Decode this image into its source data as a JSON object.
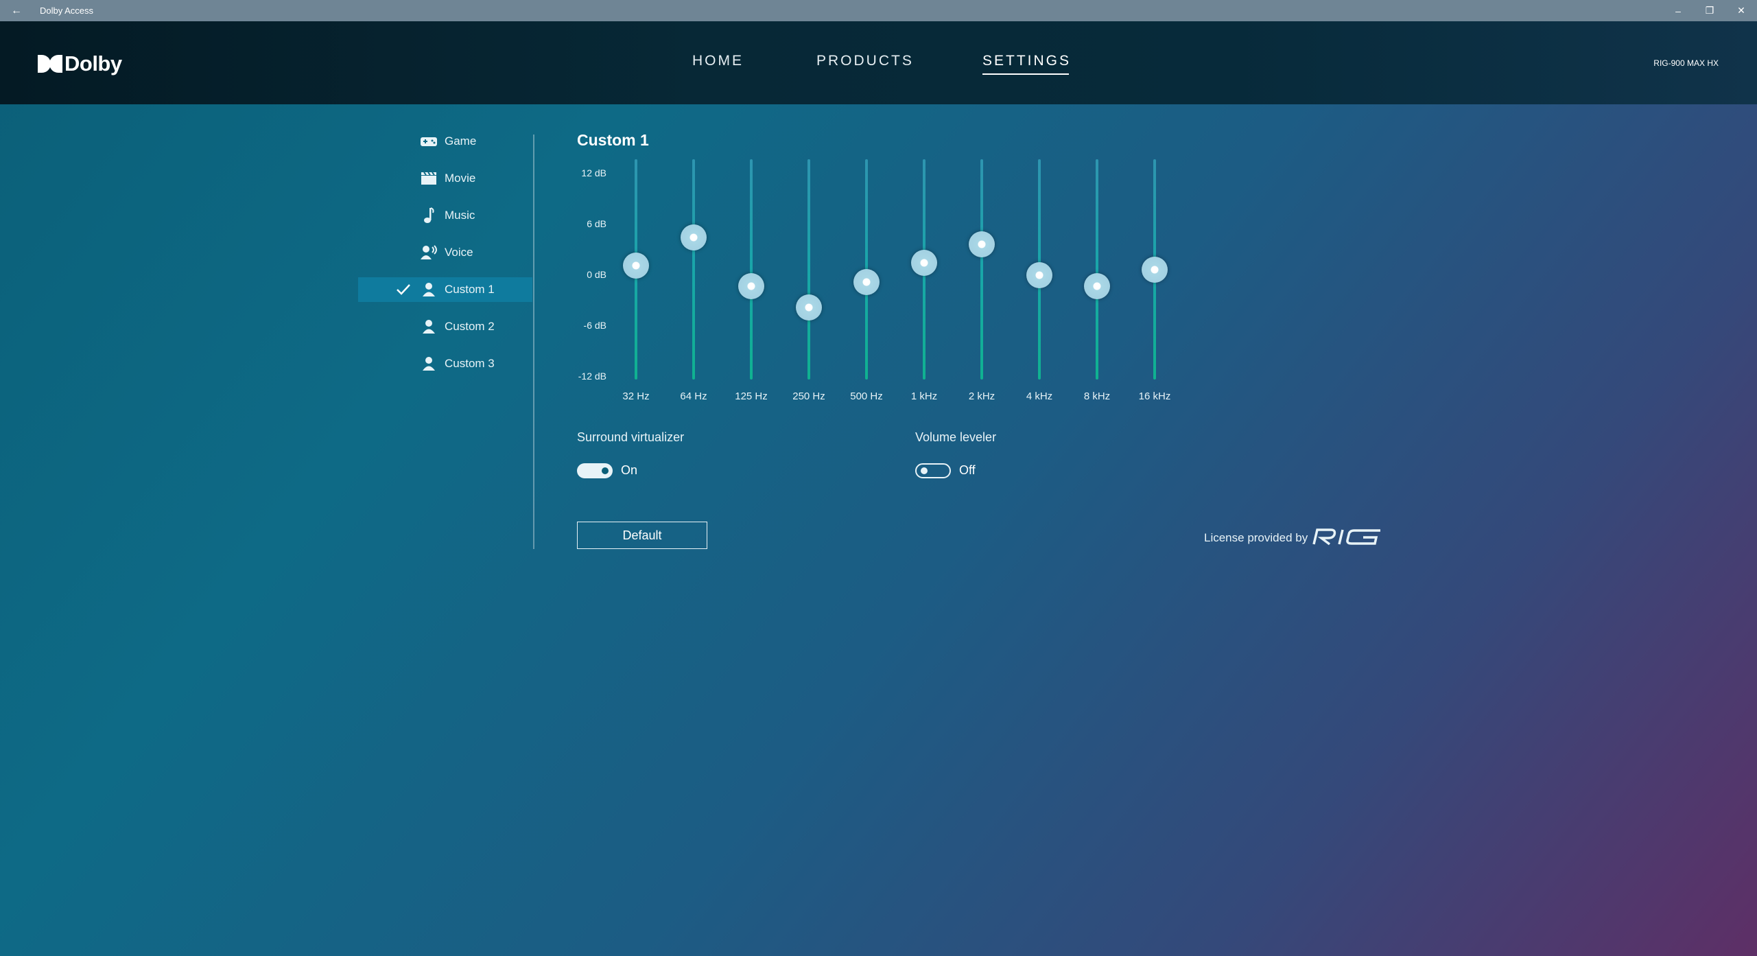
{
  "window": {
    "title": "Dolby Access"
  },
  "brand": {
    "name": "Dolby"
  },
  "nav": [
    {
      "label": "HOME",
      "active": false
    },
    {
      "label": "PRODUCTS",
      "active": false
    },
    {
      "label": "SETTINGS",
      "active": true
    }
  ],
  "device": "RIG-900 MAX HX",
  "sidebar": {
    "items": [
      {
        "label": "Game",
        "icon": "gamepad-icon",
        "selected": false
      },
      {
        "label": "Movie",
        "icon": "clapperboard-icon",
        "selected": false
      },
      {
        "label": "Music",
        "icon": "music-note-icon",
        "selected": false
      },
      {
        "label": "Voice",
        "icon": "voice-icon",
        "selected": false
      },
      {
        "label": "Custom 1",
        "icon": "person-icon",
        "selected": true
      },
      {
        "label": "Custom 2",
        "icon": "person-icon",
        "selected": false
      },
      {
        "label": "Custom 3",
        "icon": "person-icon",
        "selected": false
      }
    ]
  },
  "equalizer": {
    "title": "Custom 1",
    "db_labels": [
      "12 dB",
      "6 dB",
      "0 dB",
      "-6 dB",
      "-12 dB"
    ],
    "db_range": [
      -12,
      12
    ],
    "bands": [
      {
        "freq": "32 Hz",
        "gain_db": 1.3
      },
      {
        "freq": "64 Hz",
        "gain_db": 4.6
      },
      {
        "freq": "125 Hz",
        "gain_db": -1.2
      },
      {
        "freq": "250 Hz",
        "gain_db": -3.7
      },
      {
        "freq": "500 Hz",
        "gain_db": -0.7
      },
      {
        "freq": "1 kHz",
        "gain_db": 1.6
      },
      {
        "freq": "2 kHz",
        "gain_db": 3.8
      },
      {
        "freq": "4 kHz",
        "gain_db": 0.1
      },
      {
        "freq": "8 kHz",
        "gain_db": -1.2
      },
      {
        "freq": "16 kHz",
        "gain_db": 0.8
      }
    ]
  },
  "surround": {
    "label": "Surround virtualizer",
    "state": "On"
  },
  "leveler": {
    "label": "Volume leveler",
    "state": "Off"
  },
  "default_button": "Default",
  "license": {
    "text": "License provided by",
    "partner": "RIG"
  }
}
